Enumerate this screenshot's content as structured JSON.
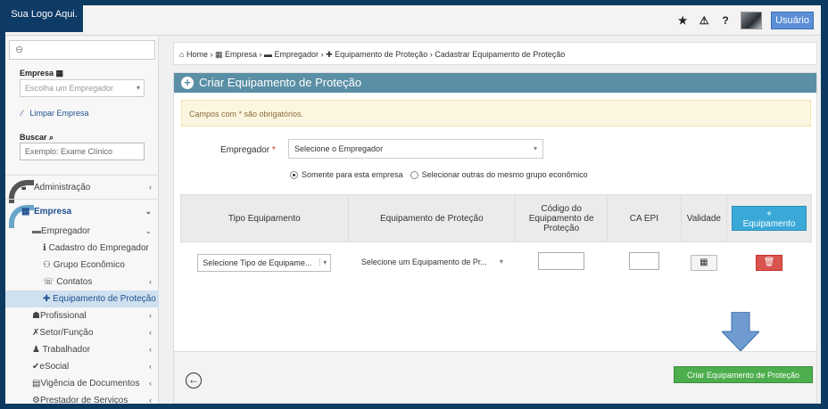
{
  "topbar": {
    "logo": "Sua Logo Aqui.",
    "icons": [
      "star-icon",
      "warning-icon",
      "help-icon"
    ],
    "user_label": "Usuário"
  },
  "sidebar": {
    "empresa_label": "Empresa",
    "empresa_placeholder": "Escolha um Empregador",
    "limpar": "Limpar Empresa",
    "buscar_label": "Buscar",
    "buscar_value": "Exemplo: Exame Clínico",
    "menu": [
      {
        "label": "Administração",
        "icon": "lock-icon"
      },
      {
        "label": "Empresa",
        "icon": "building-icon"
      },
      {
        "label": "Empregador",
        "icon": "id-card-icon"
      },
      {
        "label": "Cadastro do Empregador",
        "icon": "info-icon"
      },
      {
        "label": "Grupo Econômico",
        "icon": "group-icon"
      },
      {
        "label": "Contatos",
        "icon": "phone-icon"
      },
      {
        "label": "Equipamento de Proteção",
        "icon": "plus-icon"
      },
      {
        "label": "Profissional",
        "icon": "user-icon"
      },
      {
        "label": "Setor/Função",
        "icon": "tools-icon"
      },
      {
        "label": "Trabalhador",
        "icon": "worker-icon"
      },
      {
        "label": "eSocial",
        "icon": "check-icon"
      },
      {
        "label": "Vigência de Documentos",
        "icon": "calendar-icon"
      },
      {
        "label": "Prestador de Serviços",
        "icon": "gear-icon"
      }
    ]
  },
  "breadcrumb": {
    "home": "Home",
    "empresa": "Empresa",
    "empregador": "Empregador",
    "equip": "Equipamento de Proteção",
    "current": "Cadastrar Equipamento de Proteção"
  },
  "panel": {
    "title": "Criar Equipamento de Proteção",
    "alert": "Campos com * são obrigatórios.",
    "empregador_label": "Empregador",
    "empregador_required": "*",
    "empregador_select": "Selecione o Empregador",
    "radio_1": "Somente para esta empresa",
    "radio_2": "Selecionar outras do mesmo grupo econômico",
    "table": {
      "col_tipo": "Tipo Equipamento",
      "col_equip": "Equipamento de Proteção",
      "col_codigo": "Código do Equipamento de Proteção",
      "col_ca": "CA EPI",
      "col_validade": "Validade",
      "add_button_plus": "+",
      "add_button": "Equipamento",
      "row_tipo": "Selecione Tipo de Equipame...",
      "row_equip": "Selecione um Equipamento de Pr..."
    },
    "submit": "Criar  Equipamento de Proteção"
  }
}
